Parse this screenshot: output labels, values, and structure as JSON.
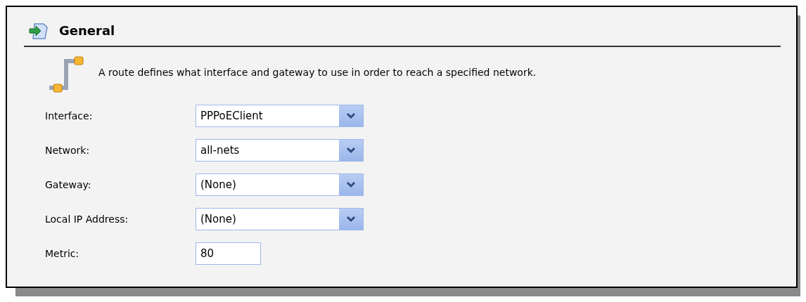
{
  "section": {
    "title": "General",
    "description": "A route defines what interface and gateway to use in order to reach a specified network."
  },
  "fields": [
    {
      "label": "Interface:",
      "kind": "select",
      "value": "PPPoEClient"
    },
    {
      "label": "Network:",
      "kind": "select",
      "value": "all-nets"
    },
    {
      "label": "Gateway:",
      "kind": "select",
      "value": "(None)"
    },
    {
      "label": "Local IP Address:",
      "kind": "select",
      "value": "(None)"
    },
    {
      "label": "Metric:",
      "kind": "text",
      "value": "80"
    }
  ]
}
